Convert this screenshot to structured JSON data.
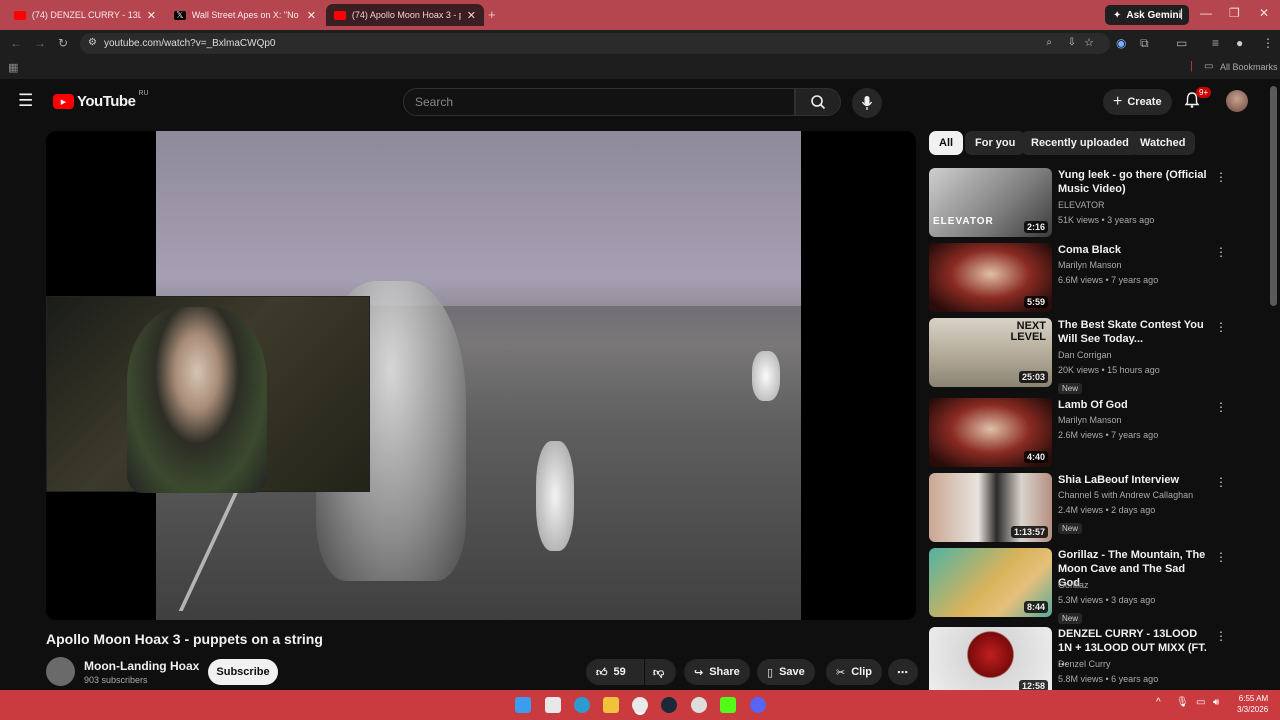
{
  "browser": {
    "tabs": [
      {
        "label": "(74) DENZEL CURRY - 13LOOD",
        "icon": "youtube-icon",
        "active": false
      },
      {
        "label": "Wall Street Apes on X: \"No long",
        "icon": "x-icon",
        "active": false
      },
      {
        "label": "(74) Apollo Moon Hoax 3 - pup",
        "icon": "youtube-icon",
        "active": true
      }
    ],
    "ask_gemini": "Ask Gemini",
    "url": "youtube.com/watch?v=_BxlmaCWQp0",
    "all_bookmarks": "All Bookmarks"
  },
  "youtube": {
    "logo_text": "YouTube",
    "region": "RU",
    "search_placeholder": "Search",
    "create_label": "Create",
    "notifications_badge": "9+",
    "video": {
      "title": "Apollo Moon Hoax 3 - puppets on a string",
      "channel": "Moon-Landing Hoax",
      "subscribers": "903 subscribers",
      "subscribe_label": "Subscribe",
      "likes": "59",
      "share_label": "Share",
      "save_label": "Save",
      "clip_label": "Clip"
    },
    "chips": [
      "All",
      "For you",
      "Recently uploaded",
      "Watched"
    ],
    "recommendations": [
      {
        "title": "Yung leek - go there (Official Music Video)",
        "channel": "ELEVATOR",
        "meta": "51K views • 3 years ago",
        "duration": "2:16",
        "new": "",
        "thumb_text": "ELEVATOR"
      },
      {
        "title": "Coma Black",
        "channel": "Marilyn Manson",
        "meta": "6.6M views • 7 years ago",
        "duration": "5:59",
        "new": "",
        "thumb_text": ""
      },
      {
        "title": "The Best Skate Contest You Will See Today...",
        "channel": "Dan Corrigan",
        "meta": "20K views • 15 hours ago",
        "duration": "25:03",
        "new": "New",
        "thumb_text": "NEXT LEVEL"
      },
      {
        "title": "Lamb Of God",
        "channel": "Marilyn Manson",
        "meta": "2.6M views • 7 years ago",
        "duration": "4:40",
        "new": "",
        "thumb_text": ""
      },
      {
        "title": "Shia LaBeouf Interview",
        "channel": "Channel 5 with Andrew Callaghan",
        "meta": "2.4M views • 2 days ago",
        "duration": "1:13:57",
        "new": "New",
        "thumb_text": ""
      },
      {
        "title": "Gorillaz - The Mountain, The Moon Cave and The Sad God",
        "channel": "Gorillaz",
        "meta": "5.3M views • 3 days ago",
        "duration": "8:44",
        "new": "New",
        "thumb_text": ""
      },
      {
        "title": "DENZEL CURRY - 13LOOD 1N + 13LOOD OUT MIXX (FT. ...",
        "channel": "Denzel Curry",
        "meta": "5.8M views • 6 years ago",
        "duration": "12:58",
        "new": "",
        "thumb_text": ""
      }
    ]
  },
  "taskbar": {
    "time": "6:55 AM",
    "date": "3/3/2026"
  },
  "colors": {
    "accent": "#ff0000",
    "tabbar": "#b5464f",
    "taskbar": "#c93b3f"
  }
}
